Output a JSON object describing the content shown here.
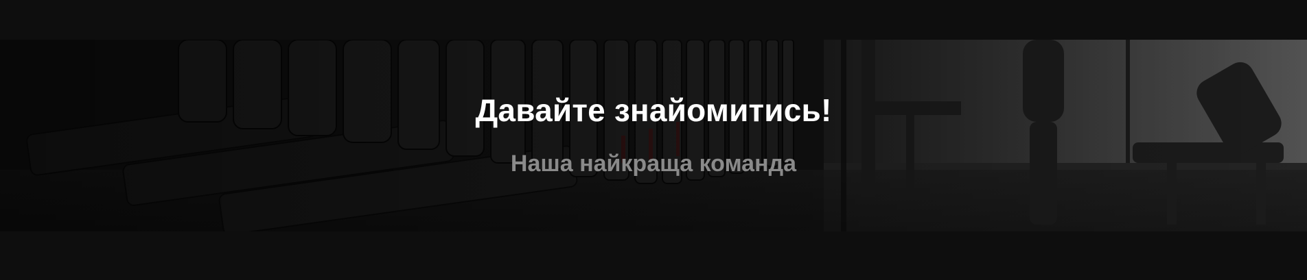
{
  "hero": {
    "title": "Давайте знайомитись!",
    "subtitle": "Наша найкраща команда",
    "background_image": "gym-dumbbell-rack-photo"
  },
  "colors": {
    "title": "#ffffff",
    "subtitle": "#8a8a8a",
    "page_background": "#0d0d0d"
  }
}
